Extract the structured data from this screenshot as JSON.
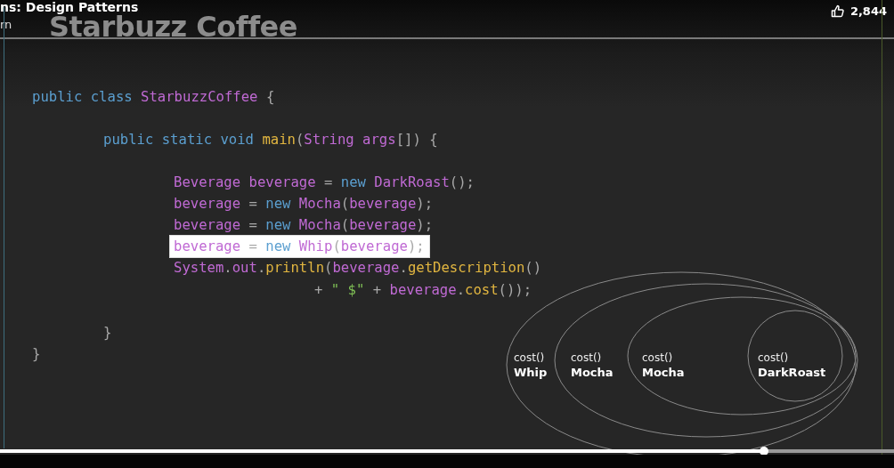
{
  "video": {
    "title": "ns: Design Patterns",
    "subtitle": "rn",
    "likes": "2,844"
  },
  "slide": {
    "title": "Starbuzz Coffee",
    "code": [
      {
        "kind": "class",
        "highlighted": false,
        "tokens": [
          {
            "t": "public class ",
            "kind": "keyword"
          },
          {
            "t": "StarbuzzCoffee",
            "kind": "name"
          },
          {
            "t": " {",
            "kind": "punct"
          }
        ]
      },
      {
        "kind": "method",
        "highlighted": false,
        "tokens": [
          {
            "t": "public static void ",
            "kind": "keyword"
          },
          {
            "t": "main",
            "kind": "func"
          },
          {
            "t": "(",
            "kind": "punct"
          },
          {
            "t": "String args",
            "kind": "name"
          },
          {
            "t": "[]) {",
            "kind": "punct"
          }
        ]
      },
      {
        "kind": "body",
        "highlighted": false,
        "tokens": [
          {
            "t": "Beverage beverage",
            "kind": "name"
          },
          {
            "t": " = ",
            "kind": "punct"
          },
          {
            "t": "new ",
            "kind": "keyword"
          },
          {
            "t": "DarkRoast",
            "kind": "name"
          },
          {
            "t": "();",
            "kind": "punct"
          }
        ]
      },
      {
        "kind": "line",
        "highlighted": false,
        "tokens": [
          {
            "t": "beverage",
            "kind": "name"
          },
          {
            "t": " = ",
            "kind": "punct"
          },
          {
            "t": "new ",
            "kind": "keyword"
          },
          {
            "t": "Mocha",
            "kind": "name"
          },
          {
            "t": "(",
            "kind": "punct"
          },
          {
            "t": "beverage",
            "kind": "name"
          },
          {
            "t": ");",
            "kind": "punct"
          }
        ]
      },
      {
        "kind": "line",
        "highlighted": false,
        "tokens": [
          {
            "t": "beverage",
            "kind": "name"
          },
          {
            "t": " = ",
            "kind": "punct"
          },
          {
            "t": "new ",
            "kind": "keyword"
          },
          {
            "t": "Mocha",
            "kind": "name"
          },
          {
            "t": "(",
            "kind": "punct"
          },
          {
            "t": "beverage",
            "kind": "name"
          },
          {
            "t": ");",
            "kind": "punct"
          }
        ]
      },
      {
        "kind": "line",
        "highlighted": true,
        "tokens": [
          {
            "t": "beverage",
            "kind": "name"
          },
          {
            "t": " = ",
            "kind": "punct"
          },
          {
            "t": "new ",
            "kind": "keyword"
          },
          {
            "t": "Whip",
            "kind": "name"
          },
          {
            "t": "(",
            "kind": "punct"
          },
          {
            "t": "beverage",
            "kind": "name"
          },
          {
            "t": ");",
            "kind": "punct"
          }
        ]
      },
      {
        "kind": "line",
        "highlighted": false,
        "tokens": [
          {
            "t": "System",
            "kind": "name"
          },
          {
            "t": ".",
            "kind": "punct"
          },
          {
            "t": "out",
            "kind": "name"
          },
          {
            "t": ".",
            "kind": "punct"
          },
          {
            "t": "println",
            "kind": "func"
          },
          {
            "t": "(",
            "kind": "punct"
          },
          {
            "t": "beverage",
            "kind": "name"
          },
          {
            "t": ".",
            "kind": "punct"
          },
          {
            "t": "getDescription",
            "kind": "func"
          },
          {
            "t": "()",
            "kind": "punct"
          }
        ]
      },
      {
        "kind": "continuation",
        "highlighted": false,
        "tokens": [
          {
            "t": "+ ",
            "kind": "punct"
          },
          {
            "t": "\" $\"",
            "kind": "string"
          },
          {
            "t": " + ",
            "kind": "punct"
          },
          {
            "t": "beverage",
            "kind": "name"
          },
          {
            "t": ".",
            "kind": "punct"
          },
          {
            "t": "cost",
            "kind": "func"
          },
          {
            "t": "());",
            "kind": "punct"
          }
        ]
      },
      {
        "kind": "close-method",
        "highlighted": false,
        "tokens": [
          {
            "t": "}",
            "kind": "punct"
          }
        ]
      },
      {
        "kind": "close-class",
        "highlighted": false,
        "tokens": [
          {
            "t": "}",
            "kind": "punct"
          }
        ]
      }
    ],
    "diagram": [
      {
        "method": "cost()",
        "name": "Whip"
      },
      {
        "method": "cost()",
        "name": "Mocha"
      },
      {
        "method": "cost()",
        "name": "Mocha"
      },
      {
        "method": "cost()",
        "name": "DarkRoast"
      }
    ]
  },
  "progress": {
    "level": 0.855
  }
}
